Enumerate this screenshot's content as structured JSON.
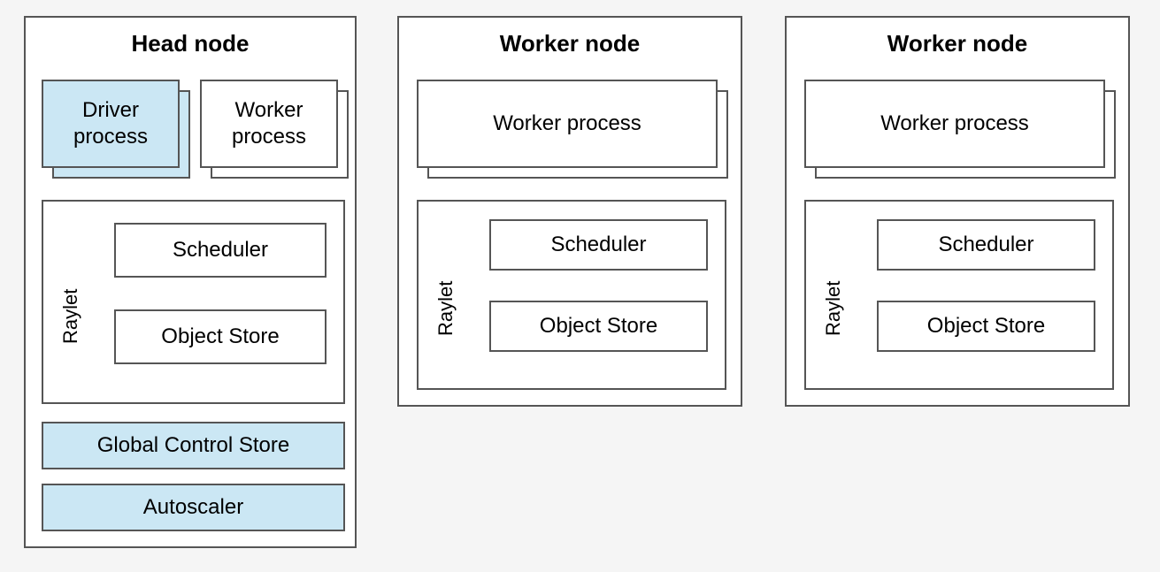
{
  "head": {
    "title": "Head node",
    "driver": "Driver process",
    "worker": "Worker process",
    "raylet": "Raylet",
    "scheduler": "Scheduler",
    "object_store": "Object Store",
    "gcs": "Global Control Store",
    "autoscaler": "Autoscaler"
  },
  "worker1": {
    "title": "Worker node",
    "worker": "Worker process",
    "raylet": "Raylet",
    "scheduler": "Scheduler",
    "object_store": "Object Store"
  },
  "worker2": {
    "title": "Worker node",
    "worker": "Worker process",
    "raylet": "Raylet",
    "scheduler": "Scheduler",
    "object_store": "Object Store"
  }
}
